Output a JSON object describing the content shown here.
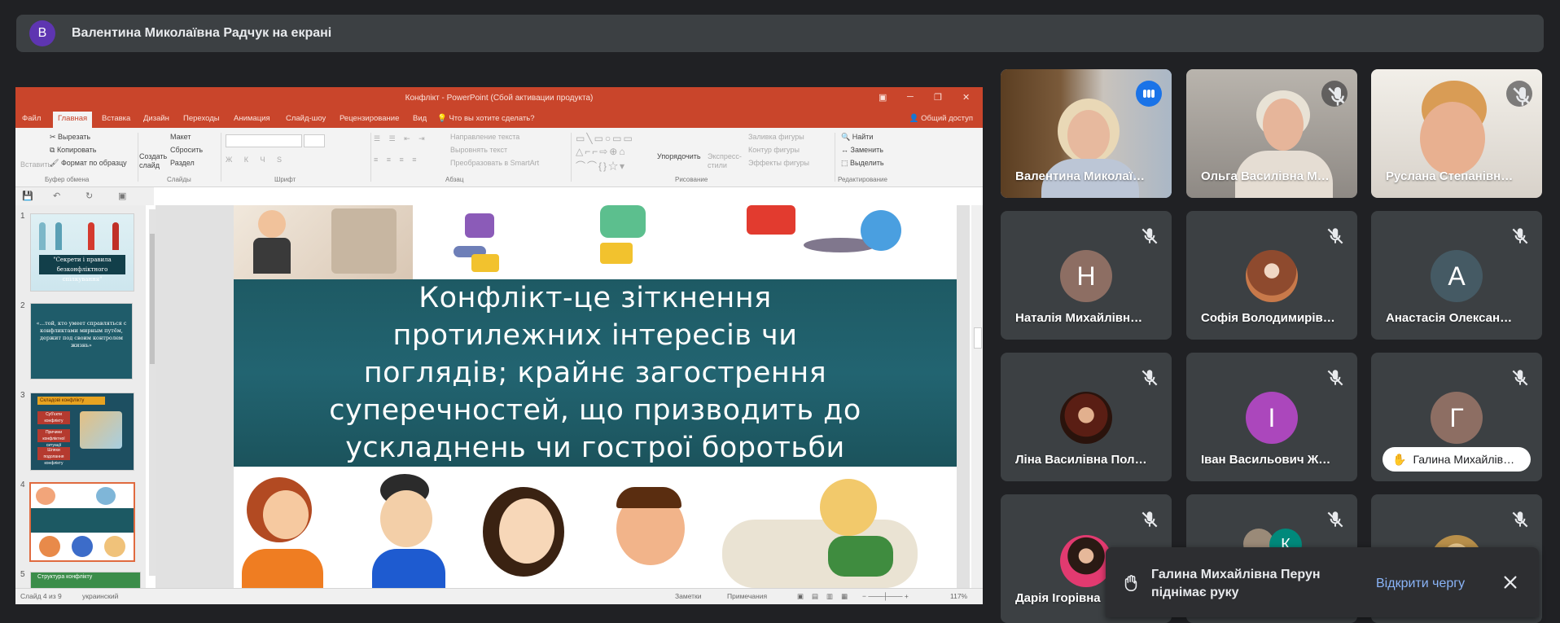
{
  "presenter_bar": {
    "avatar_letter": "В",
    "avatar_color": "#5e35b1",
    "title": "Валентина Миколаївна Радчук на екрані"
  },
  "powerpoint": {
    "window_title": "Конфлікт - PowerPoint (Сбой активации продукта)",
    "tabs": [
      "Файл",
      "Главная",
      "Вставка",
      "Дизайн",
      "Переходы",
      "Анимация",
      "Слайд-шоу",
      "Рецензирование",
      "Вид"
    ],
    "active_tab": "Главная",
    "tell_me": "Что вы хотите сделать?",
    "share_label": "Общий доступ",
    "ribbon": {
      "paste": "Вставить",
      "cut": "Вырезать",
      "copy": "Копировать",
      "format_painter": "Формат по образцу",
      "new_slide": "Создать слайд",
      "layout": "Макет",
      "reset": "Сбросить",
      "section": "Раздел",
      "text_direction": "Направление текста",
      "align_text": "Выровнять текст",
      "convert_smartart": "Преобразовать в SmartArt",
      "arrange": "Упорядочить",
      "quick_styles": "Экспресс-стили",
      "shape_fill": "Заливка фигуры",
      "shape_outline": "Контур фигуры",
      "shape_effects": "Эффекты фигуры",
      "find": "Найти",
      "replace": "Заменить",
      "select": "Выделить",
      "groups": [
        "Буфер обмена",
        "Слайды",
        "Шрифт",
        "Абзац",
        "Рисование",
        "Редактирование"
      ]
    },
    "thumbnails": [
      {
        "num": "1",
        "text": "\"Секрети і правила безконфліктного спілкування\""
      },
      {
        "num": "2",
        "text": "«…той, кто умеет справляться с конфликтами мирным путём, держит под своим контролем жизнь»"
      },
      {
        "num": "3",
        "header": "Складові конфлікту",
        "boxes": [
          "Суб'єкти конфлікту",
          "Причини конфліктної ситуації",
          "Шляхи подолання конфлікту"
        ]
      },
      {
        "num": "4",
        "text": ""
      },
      {
        "num": "5",
        "text": "Структура конфлікту"
      }
    ],
    "slide_text_lines": [
      "Конфлікт-це зіткнення",
      "протилежних інтересів чи",
      "поглядів; крайнє загострення",
      "суперечностей, що призводить до",
      "ускладнень чи гострої боротьби"
    ],
    "status": {
      "slide_info": "Слайд 4 из 9",
      "language": "украинский",
      "notes": "Заметки",
      "comments": "Примечания",
      "zoom": "117%"
    }
  },
  "participants": [
    {
      "name": "Валентина Миколаї…",
      "type": "video",
      "speaking": true
    },
    {
      "name": "Ольга Василівна М…",
      "type": "video",
      "muted": true
    },
    {
      "name": "Руслана Степанівн…",
      "type": "video",
      "muted": true
    },
    {
      "name": "Наталія Михайлівн…",
      "type": "letter",
      "letter": "Н",
      "color": "#8d6e63",
      "muted": true
    },
    {
      "name": "Софія Володимирів…",
      "type": "photo",
      "muted": true
    },
    {
      "name": "Анастасія Олексан…",
      "type": "letter",
      "letter": "А",
      "color": "#455a64",
      "muted": true
    },
    {
      "name": "Ліна Василівна Пол…",
      "type": "photo",
      "muted": true
    },
    {
      "name": "Іван Васильович Ж…",
      "type": "letter",
      "letter": "І",
      "color": "#ab47bc",
      "muted": true
    },
    {
      "name": "Галина Михайлів…",
      "type": "letter",
      "letter": "Г",
      "color": "#8d6e63",
      "muted": true,
      "hand_raised": true
    },
    {
      "name": "Дарія Ігорівна",
      "type": "photo",
      "muted": true
    },
    {
      "name": "",
      "type": "group",
      "letter": "К",
      "color": "#00897b",
      "muted": true
    },
    {
      "name": "",
      "type": "photo",
      "muted": true
    }
  ],
  "toast": {
    "message": "Галина Михайлівна Перун піднімає руку",
    "action": "Відкрити чергу",
    "icon": "hand-icon"
  },
  "colors": {
    "background": "#202124",
    "tile": "#3c4043",
    "accent": "#8ab4f8",
    "ppt_red": "#c9452b"
  }
}
